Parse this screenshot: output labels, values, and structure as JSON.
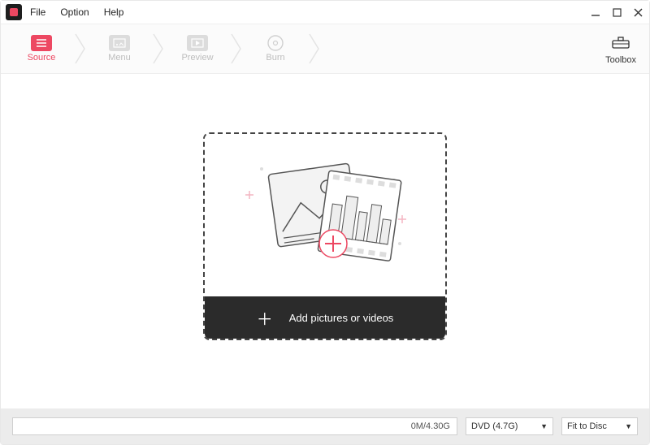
{
  "menu": {
    "file": "File",
    "option": "Option",
    "help": "Help"
  },
  "steps": {
    "source": "Source",
    "menu": "Menu",
    "preview": "Preview",
    "burn": "Burn"
  },
  "toolbox": {
    "label": "Toolbox"
  },
  "drop": {
    "add_label": "Add pictures or videos"
  },
  "bottom": {
    "capacity": "0M/4.30G",
    "disc_type": "DVD (4.7G)",
    "fit": "Fit to Disc"
  }
}
